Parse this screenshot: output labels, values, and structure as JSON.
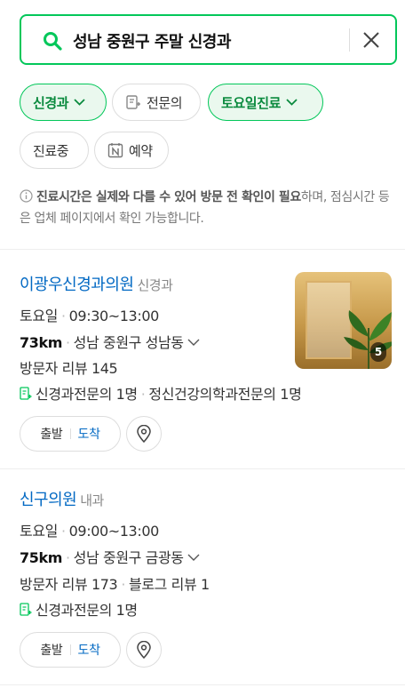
{
  "search": {
    "query": "성남 중원구 주말 신경과"
  },
  "filters": [
    {
      "label": "신경과",
      "active": true,
      "dropdown": true
    },
    {
      "label": "전문의",
      "active": false,
      "icon": "doctor-certificate-icon"
    },
    {
      "label": "토요일진료",
      "active": true,
      "dropdown": true
    },
    {
      "label": "진료중",
      "active": false
    },
    {
      "label": "예약",
      "active": false,
      "icon": "naver-booking-icon"
    }
  ],
  "notice": {
    "bold_part": "진료시간은 실제와 다를 수 있어 방문 전 확인이 필요",
    "rest": "하며, 점심시간 등은 업체 페이지에서 확인 가능합니다."
  },
  "results": [
    {
      "name": "이광우신경과의원",
      "category": "신경과",
      "hours_day": "토요일",
      "hours": "09:30~13:00",
      "distance": "73km",
      "address": "성남 중원구 성남동",
      "reviews": "방문자 리뷰 145",
      "specialists": [
        "신경과전문의 1명",
        "정신건강의학과전문의 1명"
      ],
      "photo_count": "5",
      "depart_label": "출발",
      "arrive_label": "도착"
    },
    {
      "name": "신구의원",
      "category": "내과",
      "hours_day": "토요일",
      "hours": "09:00~13:00",
      "distance": "75km",
      "address": "성남 중원구 금광동",
      "reviews": "방문자 리뷰 173",
      "blog_reviews": "블로그 리뷰 1",
      "specialists": [
        "신경과전문의 1명"
      ],
      "depart_label": "출발",
      "arrive_label": "도착"
    }
  ],
  "colors": {
    "accent": "#03c75a",
    "link": "#0068c3",
    "chip_active_bg": "#eaf8ee"
  }
}
